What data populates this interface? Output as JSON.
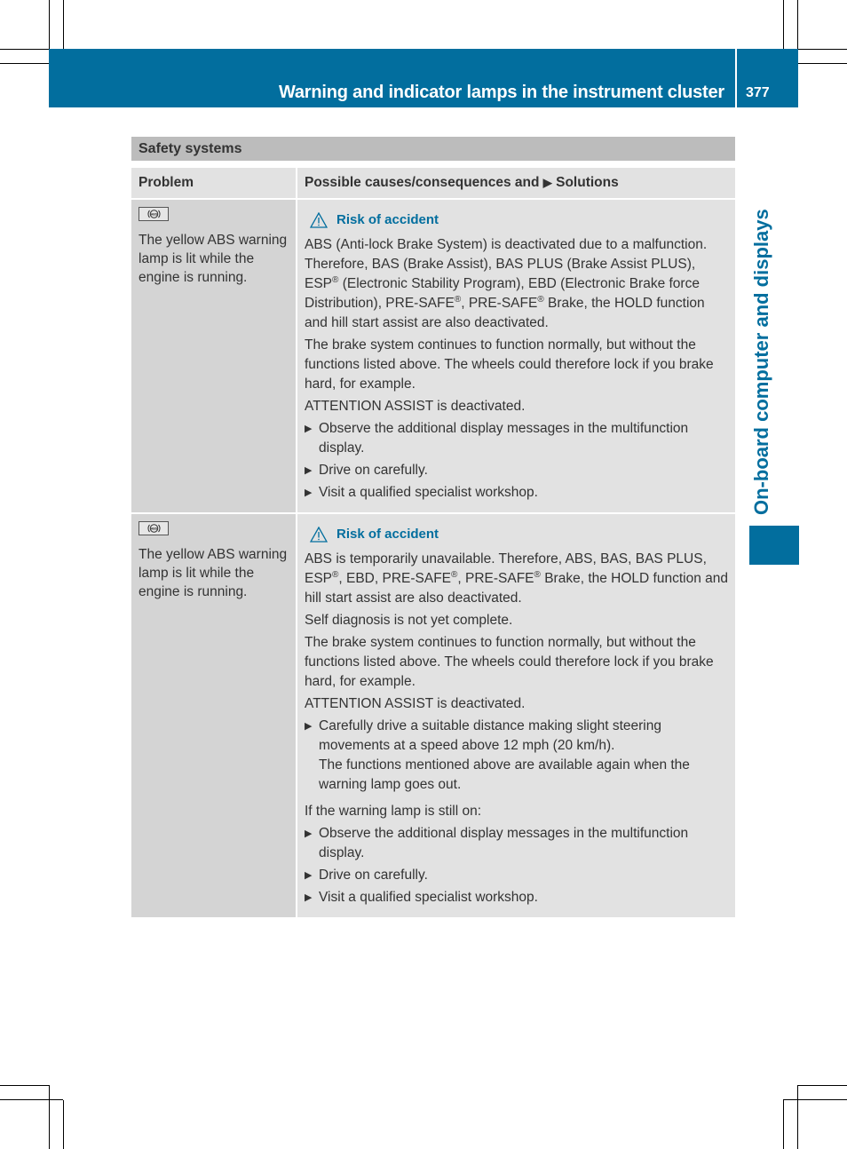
{
  "header": {
    "title": "Warning and indicator lamps in the instrument cluster",
    "page_number": "377"
  },
  "side_tab": {
    "label": "On-board computer and displays"
  },
  "section": {
    "title": "Safety systems"
  },
  "table": {
    "columns": {
      "problem": "Problem",
      "solutions_prefix": "Possible causes/consequences and",
      "solutions_arrow": "▶",
      "solutions_suffix": "Solutions"
    },
    "rows": [
      {
        "icon": "abs-warning-lamp-icon",
        "problem": "The yellow ABS warning lamp is lit while the engine is running.",
        "warning_title": "Risk of accident",
        "paragraphs": [
          "ABS (Anti-lock Brake System) is deactivated due to a malfunction. Therefore, BAS (Brake Assist), BAS PLUS (Brake Assist PLUS), ESP® (Electronic Stability Program), EBD (Electronic Brake force Distribution), PRE-SAFE®, PRE-SAFE® Brake, the HOLD function and hill start assist are also deactivated.",
          "The brake system continues to function normally, but without the functions listed above. The wheels could therefore lock if you brake hard, for example.",
          "ATTENTION ASSIST is deactivated."
        ],
        "steps": [
          "Observe the additional display messages in the multifunction display.",
          "Drive on carefully.",
          "Visit a qualified specialist workshop."
        ]
      },
      {
        "icon": "abs-warning-lamp-icon",
        "problem": "The yellow ABS warning lamp is lit while the engine is running.",
        "warning_title": "Risk of accident",
        "paragraphs": [
          "ABS is temporarily unavailable. Therefore, ABS, BAS, BAS PLUS, ESP®, EBD, PRE-SAFE®, PRE-SAFE® Brake, the HOLD function and hill start assist are also deactivated.",
          "Self diagnosis is not yet complete.",
          "The brake system continues to function normally, but without the functions listed above. The wheels could therefore lock if you brake hard, for example.",
          "ATTENTION ASSIST is deactivated."
        ],
        "steps_a": [
          "Carefully drive a suitable distance making slight steering movements at a speed above 12 mph (20 km/h)."
        ],
        "step_a_note": "The functions mentioned above are available again when the warning lamp goes out.",
        "condition": "If the warning lamp is still on:",
        "steps_b": [
          "Observe the additional display messages in the multifunction display.",
          "Drive on carefully.",
          "Visit a qualified specialist workshop."
        ]
      }
    ]
  },
  "colors": {
    "brand_blue": "#026e9e",
    "section_gray": "#bcbcbc",
    "cell_gray_dark": "#d4d4d4",
    "cell_gray_light": "#e2e2e2"
  }
}
